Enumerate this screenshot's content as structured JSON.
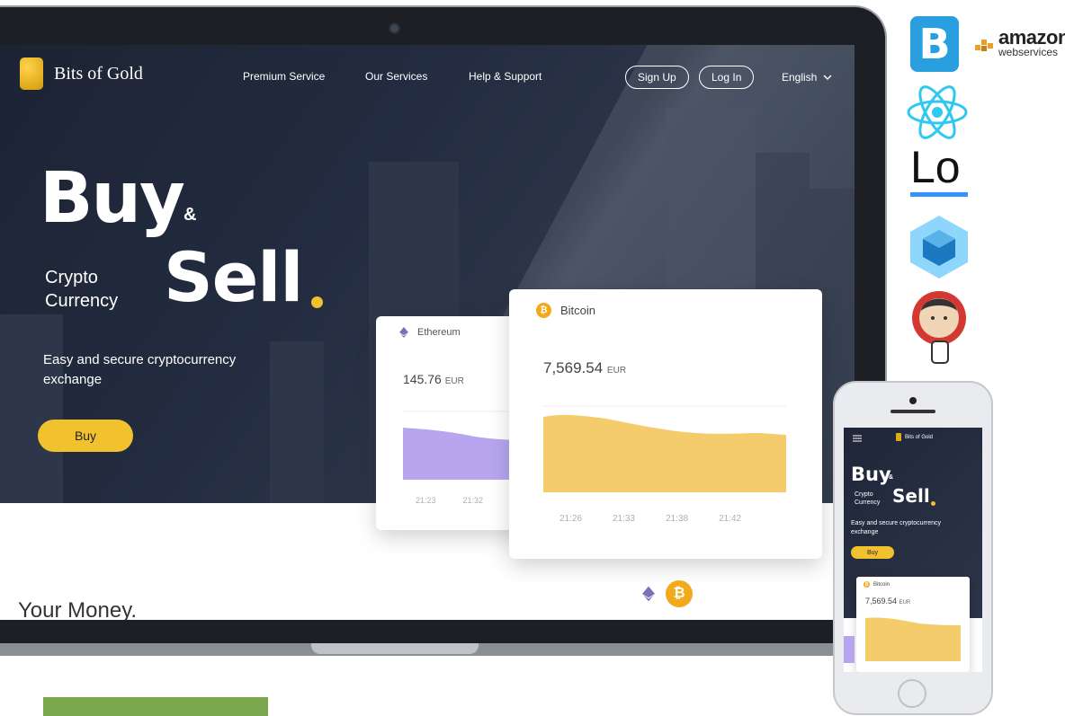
{
  "site": {
    "logo": "Bits of Gold",
    "nav": [
      "Premium Service",
      "Our Services",
      "Help & Support"
    ],
    "signup": "Sign Up",
    "login": "Log In",
    "language": "English"
  },
  "hero": {
    "buy": "Buy",
    "amp": "&",
    "crypto_line1": "Crypto",
    "crypto_line2": "Currency",
    "sell": "Sell",
    "tagline": "Easy and secure cryptocurrency exchange",
    "buy_button": "Buy"
  },
  "cards": {
    "ethereum": {
      "name": "Ethereum",
      "value": "145.76",
      "unit": "EUR",
      "ticks": [
        "21:23",
        "21:32"
      ],
      "color": "#b7a6ef"
    },
    "bitcoin": {
      "name": "Bitcoin",
      "value": "7,569.54",
      "unit": "EUR",
      "ticks": [
        "21:26",
        "21:33",
        "21:38",
        "21:42"
      ],
      "color": "#f5cc6b"
    }
  },
  "section": {
    "heading": "Your Money."
  },
  "tech_logos": {
    "amazon_word": "amazon",
    "amazon_sub": "webservices",
    "lodash": "Lo"
  },
  "phone": {
    "logo": "Bits of Gold",
    "buy": "Buy",
    "amp": "&",
    "crypto_line1": "Crypto",
    "crypto_line2": "Currency",
    "sell": "Sell",
    "tagline": "Easy and secure cryptocurrency exchange",
    "buy_button": "Buy",
    "card_name": "Bitcoin",
    "card_value": "7,569.54",
    "card_unit": "EUR"
  },
  "colors": {
    "accent": "#f2c12e",
    "hero_bg": "#232c40",
    "eth_fill": "#b7a6ef",
    "btc_fill": "#f5cc6b"
  },
  "icons": [
    "bits-of-gold-logo-icon",
    "chevron-down-icon",
    "ethereum-icon",
    "bitcoin-icon",
    "menu-icon",
    "bootstrap-logo-icon",
    "react-logo-icon",
    "webpack-logo-icon",
    "jenkins-logo-icon",
    "aws-logo-icon"
  ]
}
